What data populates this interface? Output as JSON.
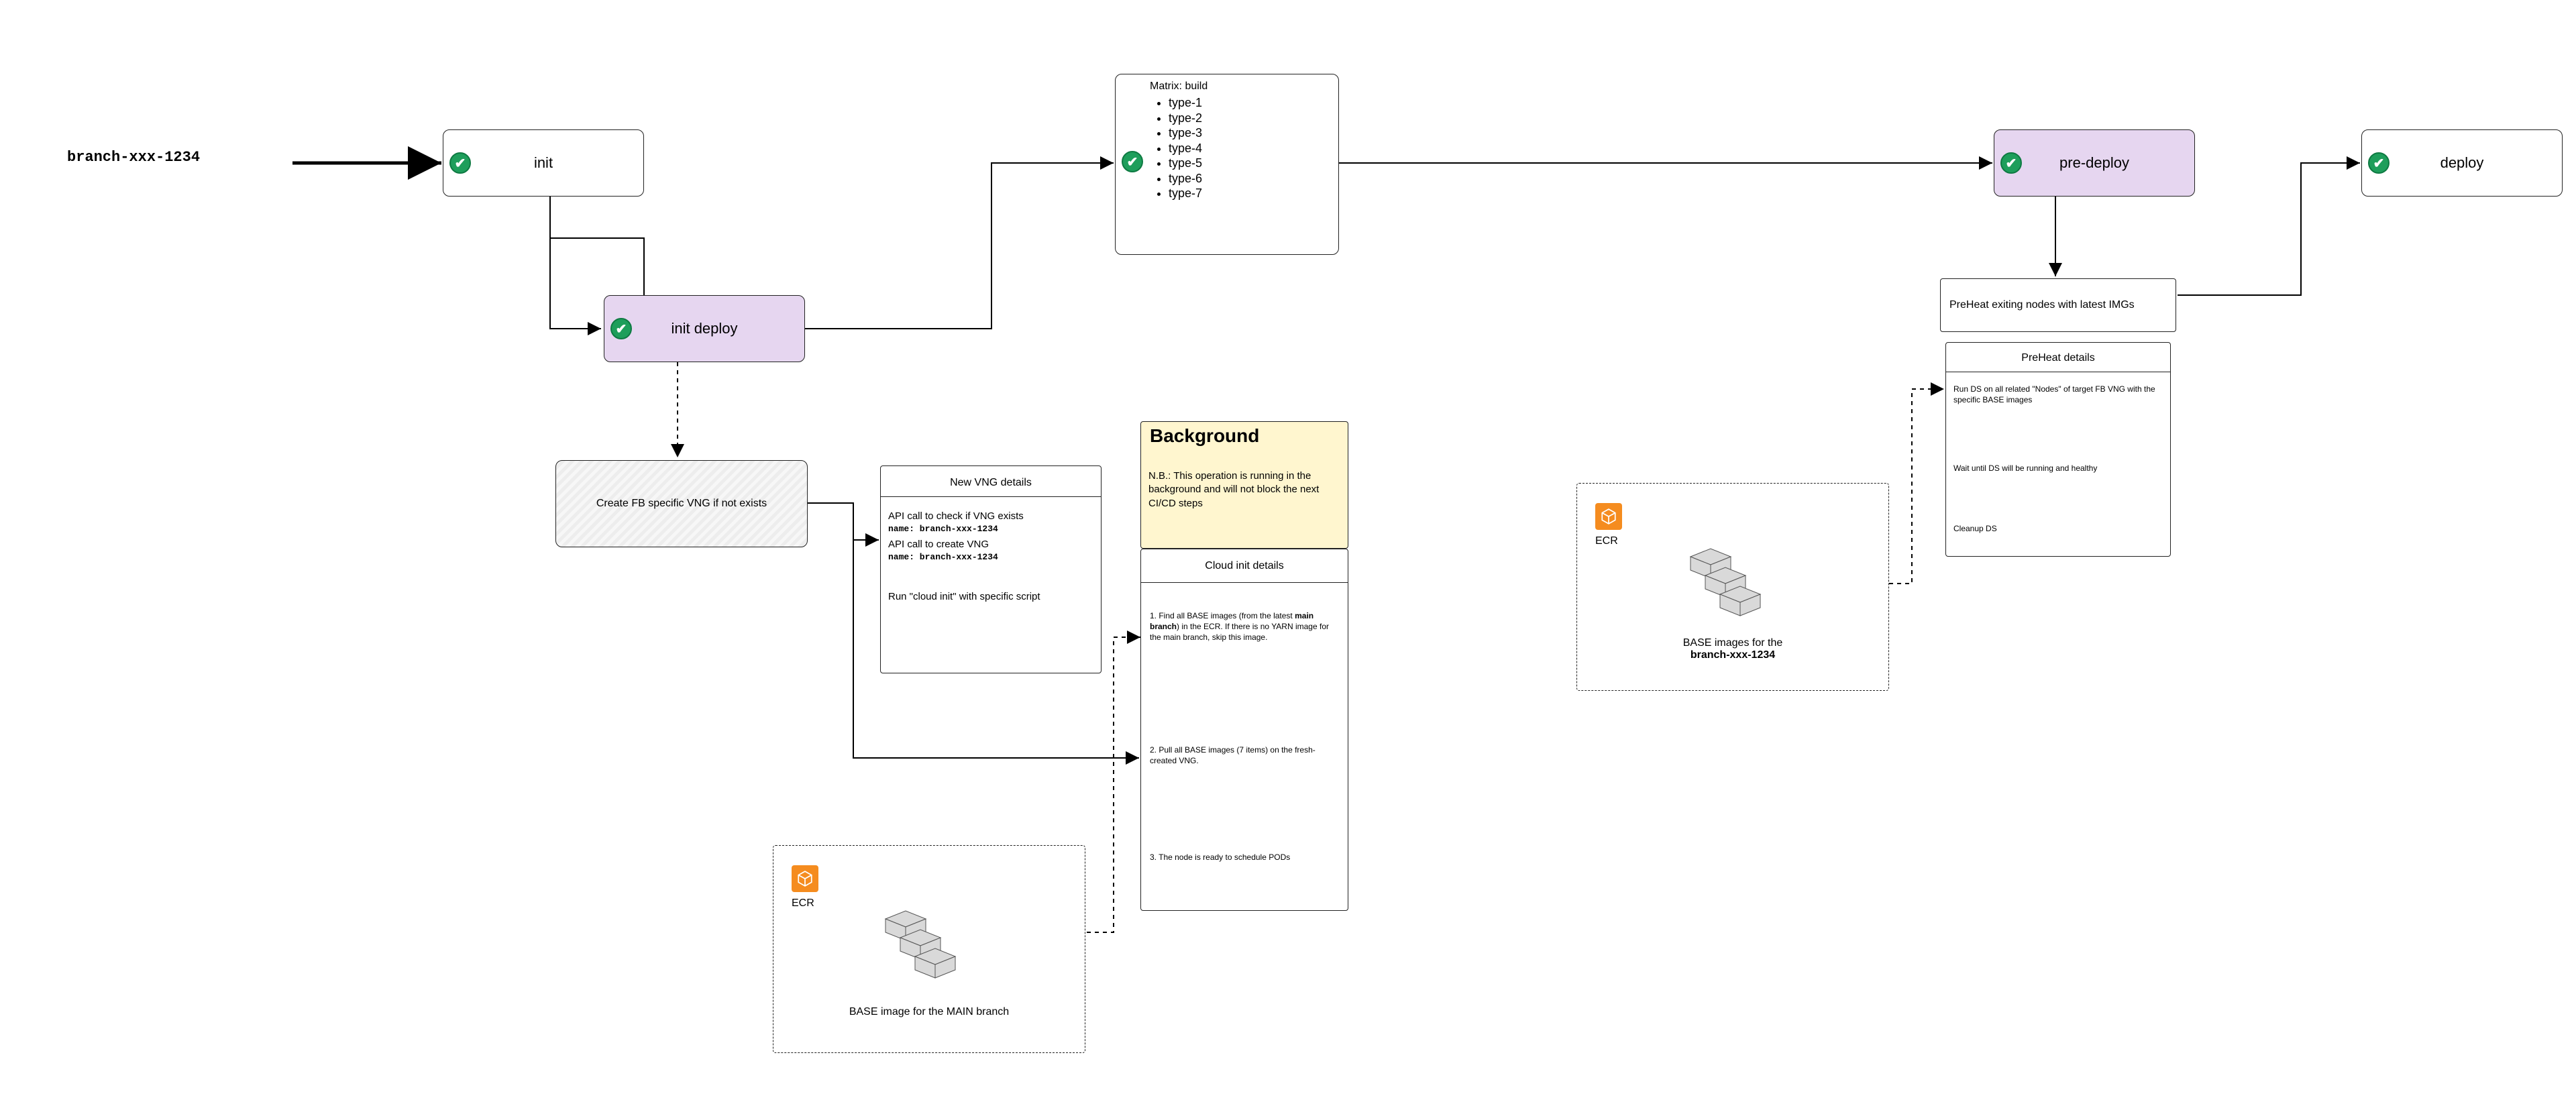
{
  "start_label": "branch-xxx-1234",
  "nodes": {
    "init": "init",
    "init_deploy": "init deploy",
    "matrix_title": "Matrix: build",
    "matrix_items": [
      "type-1",
      "type-2",
      "type-3",
      "type-4",
      "type-5",
      "type-6",
      "type-7"
    ],
    "pre_deploy": "pre-deploy",
    "deploy": "deploy",
    "create_vng": "Create FB specific VNG if not exists",
    "new_vng_title": "New VNG details",
    "new_vng_body_1": "API call to check if VNG exists",
    "new_vng_body_2": "name: branch-xxx-1234",
    "new_vng_body_3": "API call to create VNG",
    "new_vng_body_4": "name: branch-xxx-1234",
    "new_vng_body_5": "Run \"cloud init\" with specific script",
    "bg_title": "Background",
    "bg_body": "N.B.: This operation is running in the background and will not block the next CI/CD steps",
    "cloud_init_title": "Cloud init details",
    "cloud_init_1a": "1. Find all BASE images (from the latest ",
    "cloud_init_1b": "main branch",
    "cloud_init_1c": ") in the ECR. If there is no YARN image for the main branch, skip this image.",
    "cloud_init_2": "2. Pull all BASE images (7 items) on the fresh-created VNG.",
    "cloud_init_3": "3. The node is ready to schedule PODs",
    "ecr_main_label": "ECR",
    "ecr_main_caption": "BASE image for the MAIN branch",
    "preheat_nodes": "PreHeat exiting nodes with latest IMGs",
    "preheat_title": "PreHeat details",
    "preheat_1": "Run DS on all related \"Nodes\" of target FB VNG with the specific BASE images",
    "preheat_2": "Wait until DS will be running and healthy",
    "preheat_3": "Cleanup DS",
    "ecr_branch_label": "ECR",
    "ecr_branch_caption_a": "BASE images for the",
    "ecr_branch_caption_b": "branch-xxx-1234"
  }
}
